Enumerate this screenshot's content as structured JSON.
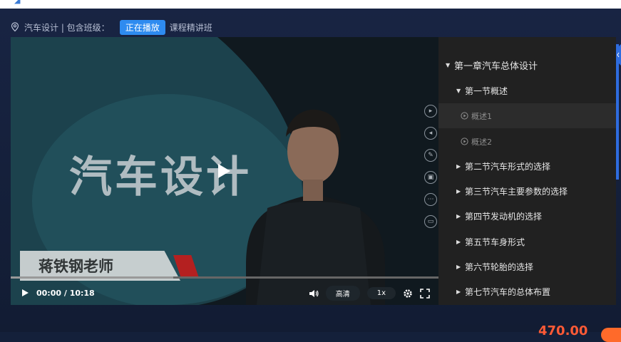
{
  "breadcrumb": {
    "course": "汽车设计 | 包含班级：",
    "badge": "正在播放",
    "class_name": "课程精讲班"
  },
  "video": {
    "overlay_title": "汽车设计",
    "teacher_name": "蒋铁钢老师",
    "time": "00:00 / 10:18",
    "quality": "高清",
    "speed": "1x",
    "progress": 0.38
  },
  "chapters": {
    "chapter": "第一章汽车总体设计",
    "sections": [
      {
        "label": "第一节概述",
        "expanded": true
      },
      {
        "label": "第二节汽车形式的选择"
      },
      {
        "label": "第三节汽车主要参数的选择"
      },
      {
        "label": "第四节发动机的选择"
      },
      {
        "label": "第五节车身形式"
      },
      {
        "label": "第六节轮胎的选择"
      },
      {
        "label": "第七节汽车的总体布置"
      }
    ],
    "lessons": [
      {
        "label": "概述1",
        "active": true
      },
      {
        "label": "概述2"
      }
    ]
  },
  "price": "470.00",
  "colors": {
    "accent": "#2e8bf0",
    "price": "#ff5a36"
  }
}
